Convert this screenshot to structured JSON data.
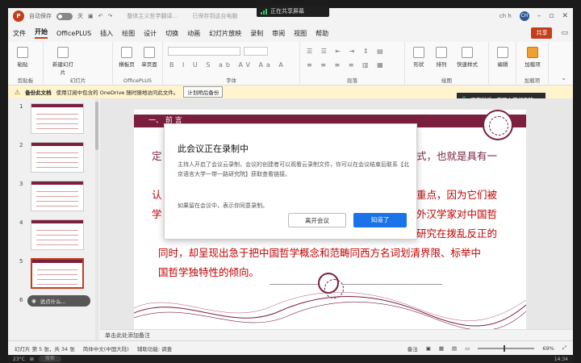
{
  "titlebar": {
    "autosave_label": "自动保存",
    "autosave_state": "关",
    "doc_title": "整体主义哲学翻译…",
    "saved_state": "已保存到这台电脑",
    "user_initials": "CH",
    "user_name": "ch h"
  },
  "share_banner": {
    "text": "正在共享屏幕"
  },
  "menubar": {
    "tabs": [
      "文件",
      "开始",
      "OfficePLUS",
      "插入",
      "绘图",
      "设计",
      "切换",
      "动画",
      "幻灯片放映",
      "录制",
      "审阅",
      "视图",
      "帮助"
    ],
    "active_tab": "开始",
    "share_button": "共享"
  },
  "ribbon": {
    "groups": [
      "剪贴板",
      "幻灯片",
      "OfficePLUS",
      "字体",
      "段落",
      "绘图",
      "加载项"
    ],
    "buttons": {
      "paste": "粘贴",
      "new_slide": "新建幻灯片",
      "template": "横板页",
      "single": "单页面",
      "shape": "形状",
      "arrange": "排列",
      "quick_style": "快速样式",
      "edit": "编辑",
      "addins": "加载项"
    }
  },
  "notice": {
    "label": "备份此文档",
    "text": "使用订阅中包含的 OneDrive 随时随地访问此文件。",
    "button": "计划稍后备份"
  },
  "speaker": {
    "label": "正在讲话:",
    "name": "南开大学胡春铭"
  },
  "thumbnails": {
    "numbers": [
      "1",
      "2",
      "3",
      "4",
      "5",
      "6"
    ],
    "selected": "5"
  },
  "tooltip_pill": {
    "text": "说点什么..."
  },
  "slide": {
    "heading": "一、 前 言",
    "line1": "式，也就是具有一",
    "line1_prefix": "定",
    "line2": "重点，因为它们被",
    "line2_prefix": "认",
    "line3": "外汉学家对中国哲",
    "line3_prefix": "学",
    "line4": "研究在拨乱反正的",
    "line5": "同时，却呈现出急于把中国哲学概念和范畴同西方名词划清界限、标举中",
    "line6": "国哲学独特性的倾向。"
  },
  "notes": {
    "placeholder": "单击此处添加备注"
  },
  "modal": {
    "title": "此会议正在录制中",
    "body": "主持人开启了会议云录制，会议的创建者可以观看云录制文件，你可以在会议结束后联系【北京语言大学一带一路研究院】获取查看链接。",
    "note": "如果留在会议中，表示你同意录制。",
    "leave_button": "离开会议",
    "ok_button": "知道了"
  },
  "statusbar": {
    "slide_count": "幻灯片 第 5 张，共 34 张",
    "language": "简体中文(中国大陆)",
    "accessibility": "辅助功能: 调查",
    "notes_btn": "备注",
    "zoom": "69%"
  },
  "taskbar": {
    "search": "搜索",
    "time": "14:34",
    "weather": "23°C"
  },
  "colors": {
    "accent": "#c43e1c",
    "brand_maroon": "#7a1f3d",
    "slide_red": "#c00000",
    "ok_blue": "#1a73e8"
  }
}
